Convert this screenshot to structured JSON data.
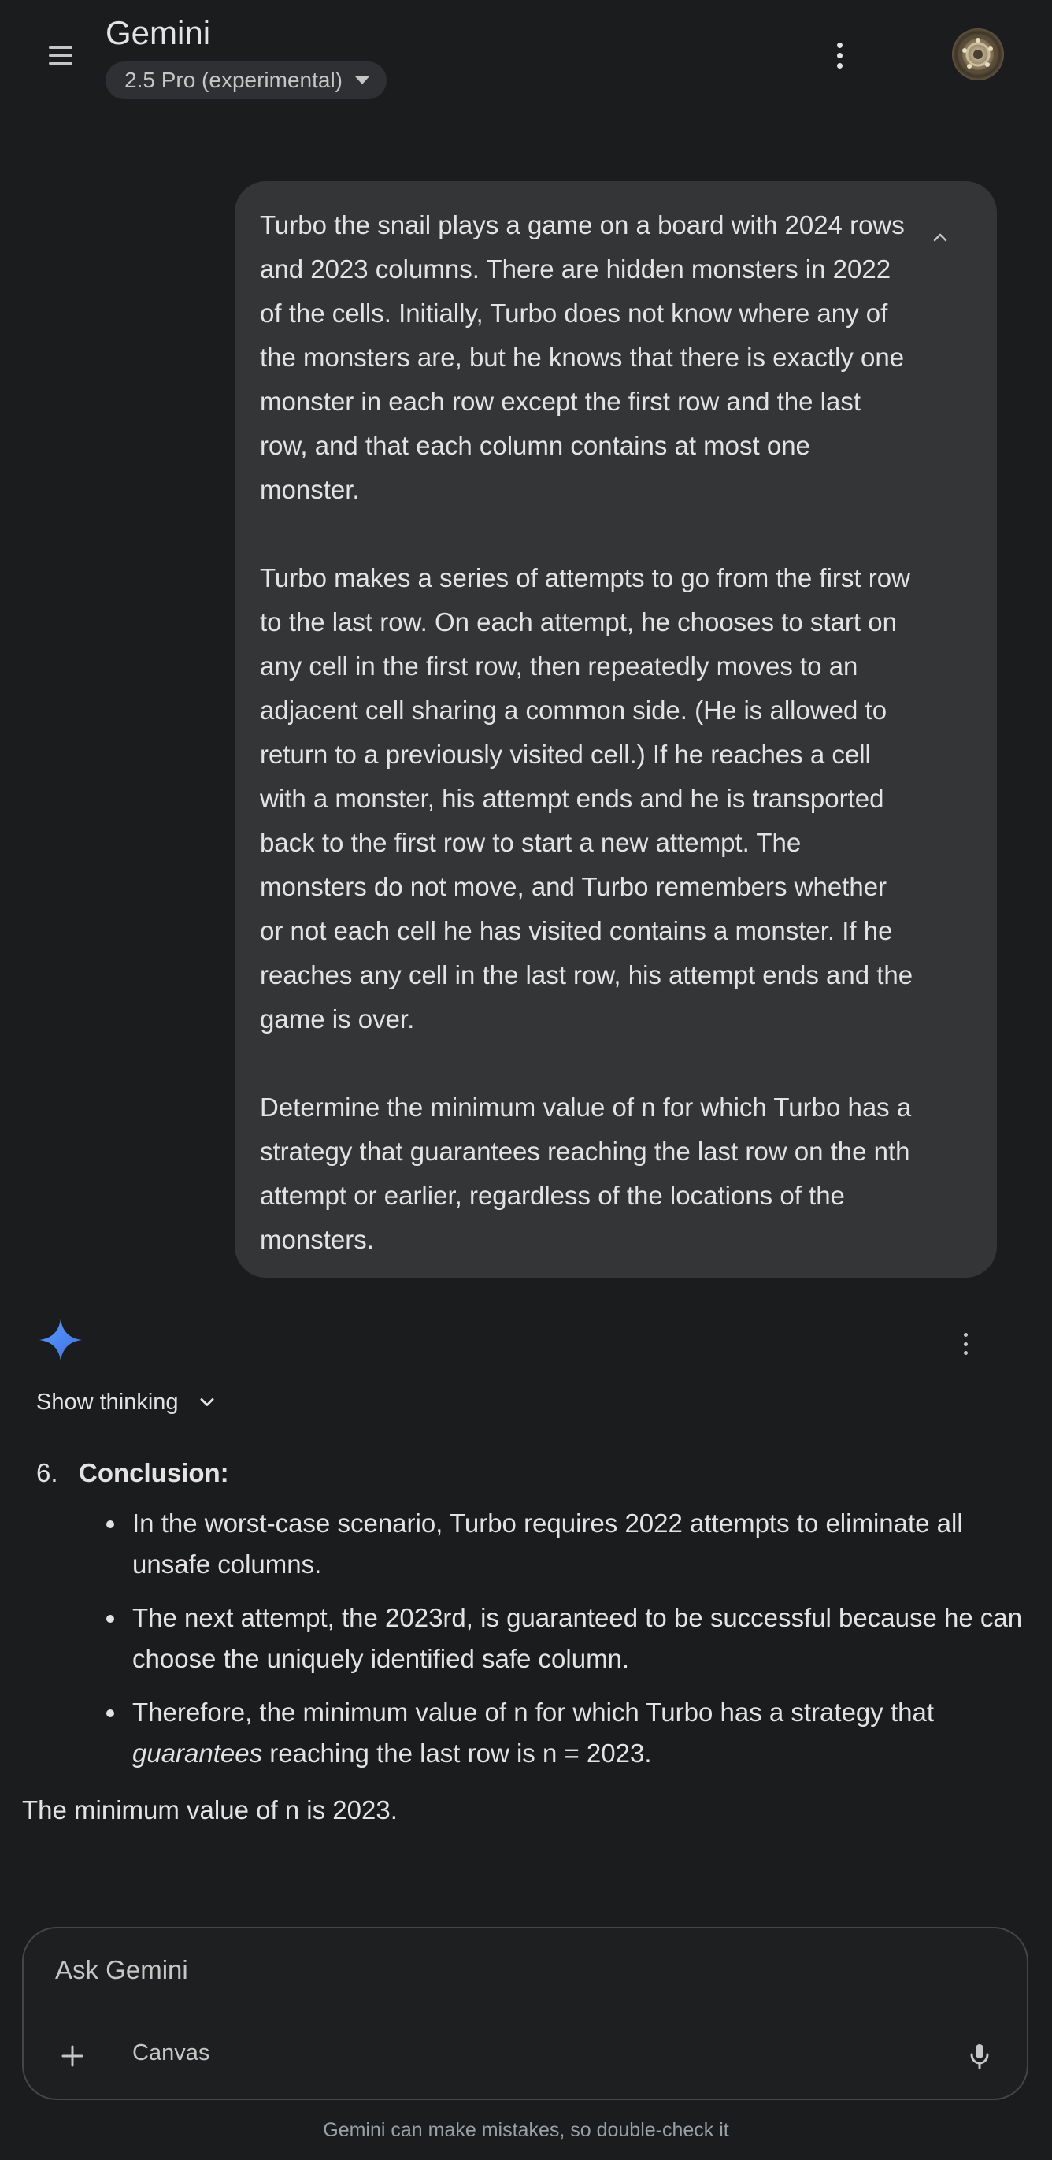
{
  "header": {
    "title": "Gemini",
    "model_label": "2.5 Pro (experimental)",
    "menu_icon": "hamburger-menu-icon",
    "more_icon": "vertical-dots-icon"
  },
  "user_message": {
    "paragraphs": [
      "Turbo the snail plays a game on a board with 2024 rows and 2023 columns. There are hidden monsters in 2022 of the cells. Initially, Turbo does not know where any of the monsters are, but he knows that there is exactly one monster in each row except the first row and the last row, and that each column contains at most one monster.",
      "Turbo makes a series of attempts to go from the first row to the last row. On each attempt, he chooses to start on any cell in the first row, then repeatedly moves to an adjacent cell sharing a common side. (He is allowed to return to a previously visited cell.) If he reaches a cell with a monster, his attempt ends and he is transported back to the first row to start a new attempt. The monsters do not move, and Turbo remembers whether or not each cell he has visited contains a monster. If he reaches any cell in the last row, his attempt ends and the game is over.",
      "Determine the minimum value of n for which Turbo has a strategy that guarantees reaching the last row on the nth attempt or earlier, regardless of the locations of the monsters."
    ]
  },
  "response": {
    "show_thinking_label": "Show thinking",
    "item_number": "6.",
    "item_heading": "Conclusion:",
    "bullets": {
      "b1": "In the worst-case scenario, Turbo requires 2022 attempts to eliminate all unsafe columns.",
      "b2": "The next attempt, the 2023rd, is guaranteed to be successful because he can choose the uniquely identified safe column.",
      "b3_before": "Therefore, the minimum value of n for which Turbo has a strategy that ",
      "b3_emph": "guarantees",
      "b3_after": " reaching the last row is n = 2023."
    },
    "final_line": "The minimum value of n is 2023."
  },
  "input": {
    "placeholder": "Ask Gemini",
    "canvas_label": "Canvas"
  },
  "footer": {
    "disclaimer": "Gemini can make mistakes, so double-check it"
  },
  "colors": {
    "background": "#1b1c1e",
    "bubble": "#333537",
    "chip": "#2f3033",
    "spark_blue": "#4a86f7"
  }
}
